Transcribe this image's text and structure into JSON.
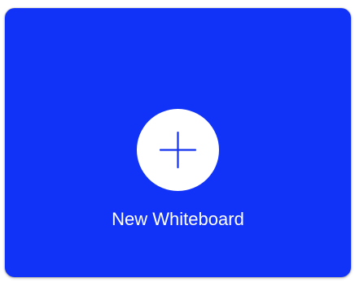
{
  "card": {
    "label": "New Whiteboard",
    "icon": "plus-icon",
    "background_color": "#1033f7",
    "icon_circle_color": "#ffffff",
    "icon_stroke_color": "#1433ee",
    "label_color": "#ffffff"
  }
}
